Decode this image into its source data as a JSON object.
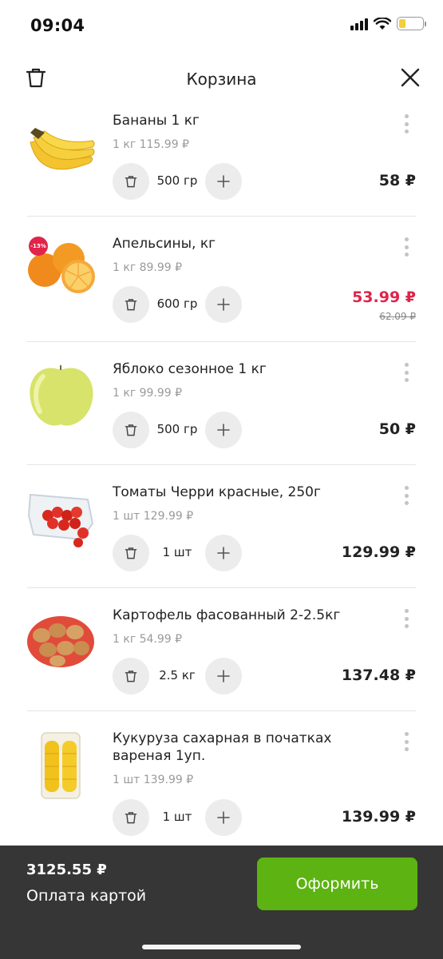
{
  "status_bar": {
    "time": "09:04"
  },
  "header": {
    "title": "Корзина"
  },
  "items": [
    {
      "name": "Бананы 1 кг",
      "unit_price": "1 кг 115.99 ₽",
      "quantity": "500 гр",
      "price": "58 ₽",
      "old_price": "",
      "sale": false,
      "discount": ""
    },
    {
      "name": "Апельсины, кг",
      "unit_price": "1 кг 89.99 ₽",
      "quantity": "600 гр",
      "price": "53.99 ₽",
      "old_price": "62.09 ₽",
      "sale": true,
      "discount": "-13%"
    },
    {
      "name": "Яблоко сезонное 1 кг",
      "unit_price": "1 кг 99.99 ₽",
      "quantity": "500 гр",
      "price": "50 ₽",
      "old_price": "",
      "sale": false,
      "discount": ""
    },
    {
      "name": "Томаты Черри красные, 250г",
      "unit_price": "1 шт 129.99 ₽",
      "quantity": "1 шт",
      "price": "129.99 ₽",
      "old_price": "",
      "sale": false,
      "discount": ""
    },
    {
      "name": "Картофель фасованный 2-2.5кг",
      "unit_price": "1 кг 54.99 ₽",
      "quantity": "2.5 кг",
      "price": "137.48 ₽",
      "old_price": "",
      "sale": false,
      "discount": ""
    },
    {
      "name": "Кукуруза сахарная в початках вареная 1уп.",
      "unit_price": "1 шт 139.99 ₽",
      "quantity": "1 шт",
      "price": "139.99 ₽",
      "old_price": "",
      "sale": false,
      "discount": ""
    }
  ],
  "footer": {
    "total": "3125.55 ₽",
    "payment_method": "Оплата картой",
    "checkout_label": "Оформить"
  },
  "colors": {
    "accent_green": "#5cb311",
    "sale_red": "#e0244a",
    "footer_bg": "#363636"
  }
}
